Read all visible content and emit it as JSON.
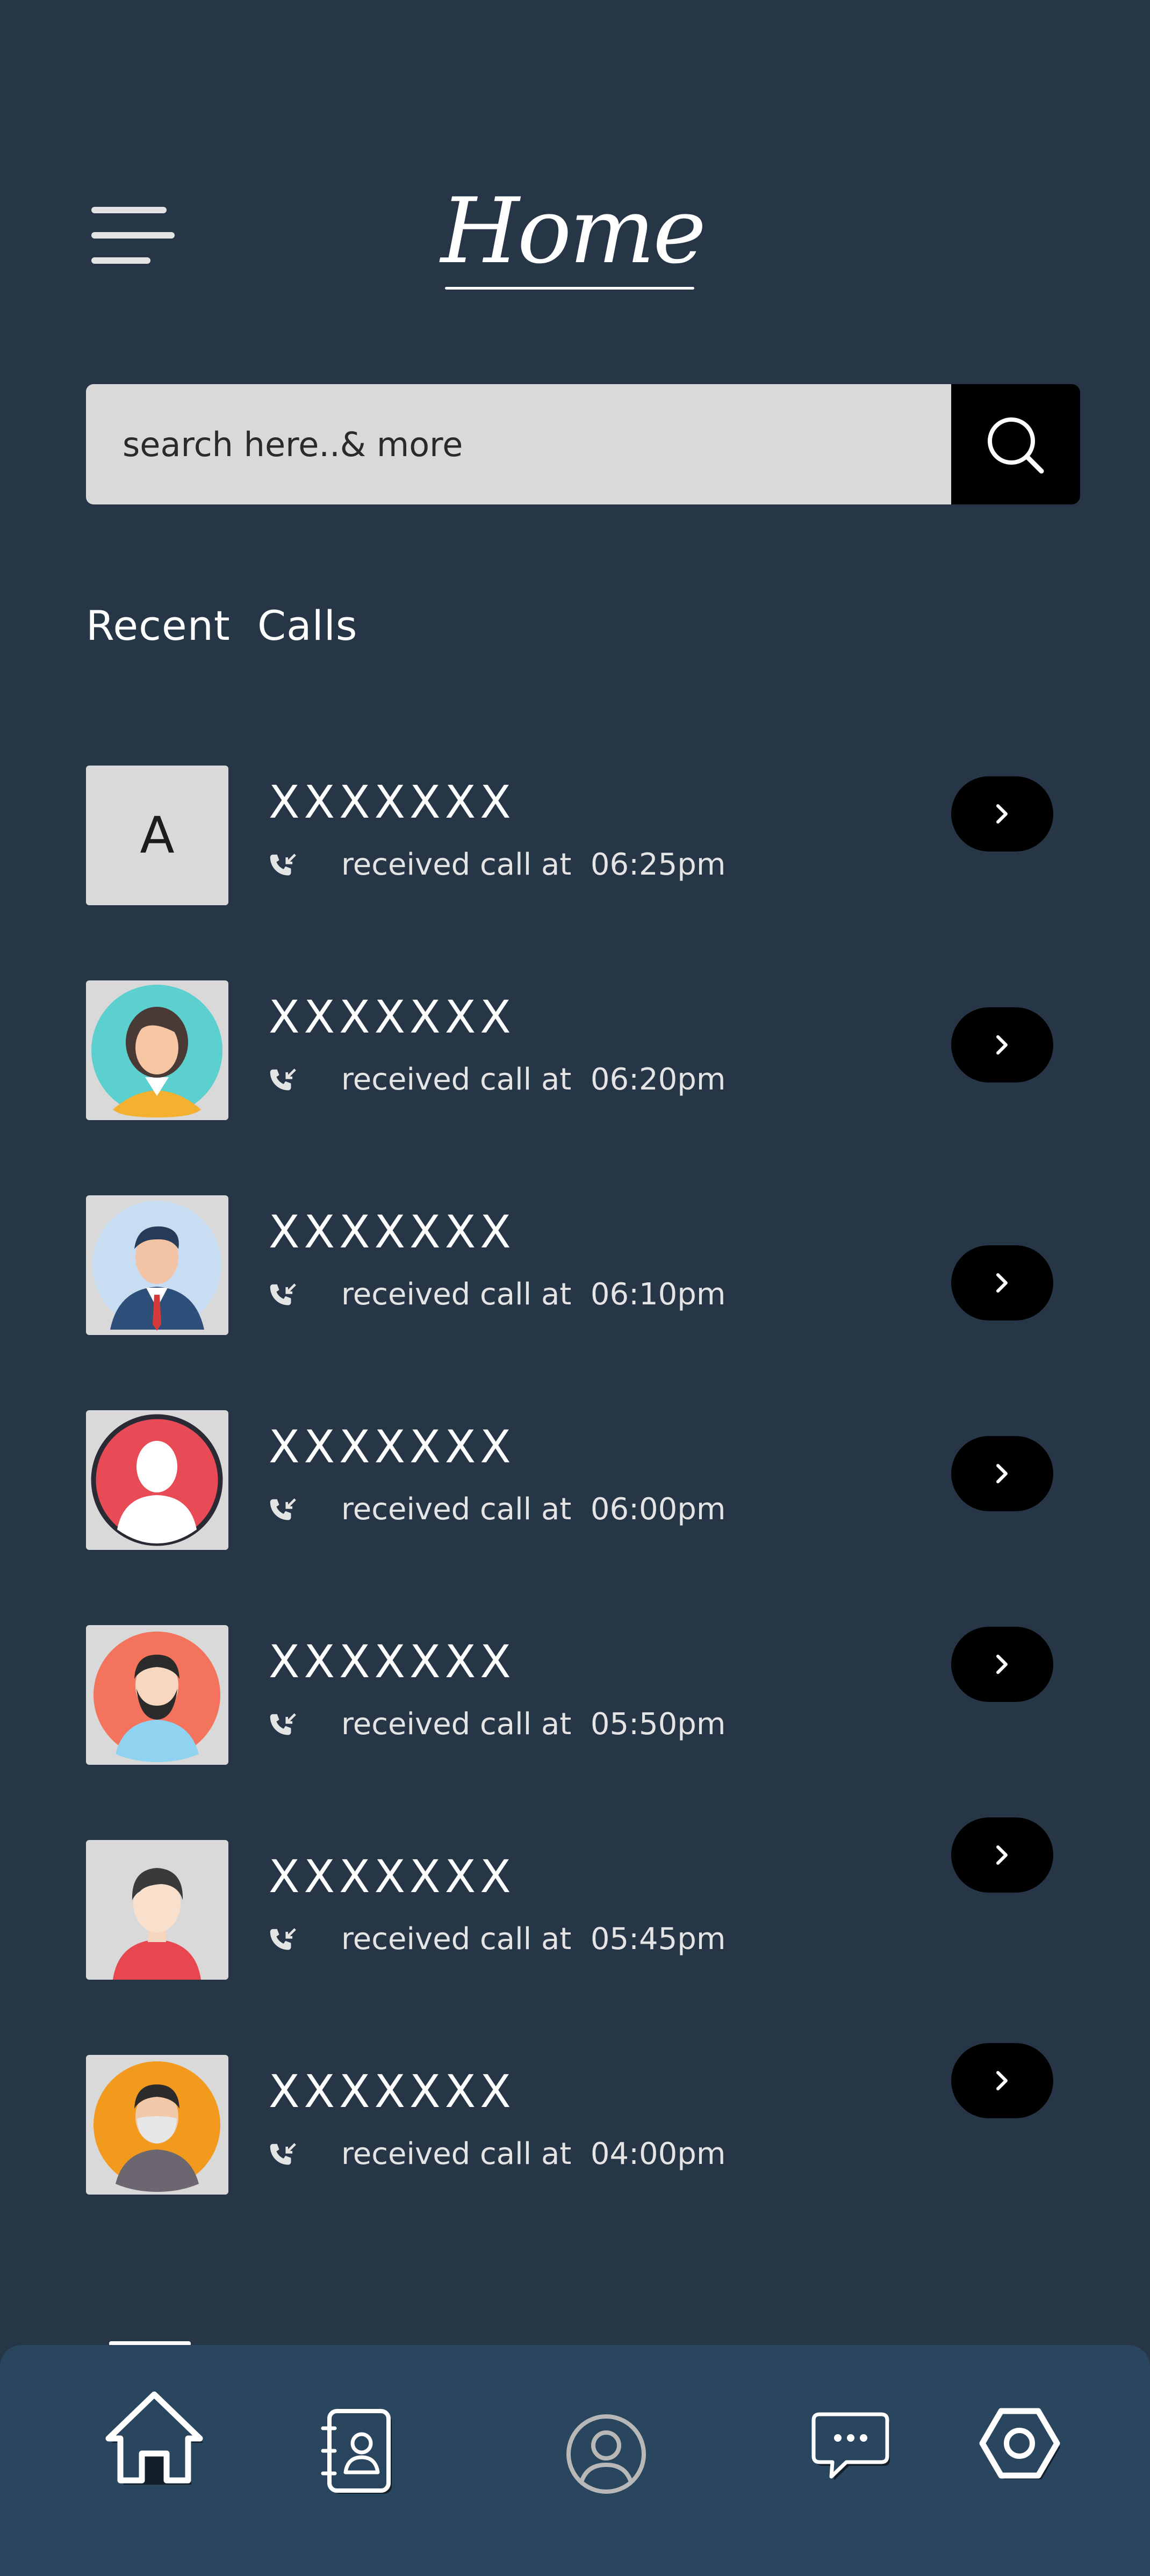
{
  "header": {
    "title": "Home"
  },
  "search": {
    "placeholder": "search here..& more"
  },
  "recent": {
    "heading": "Recent  Calls",
    "calls": [
      {
        "name": "XXXXXXX",
        "status": "received call at  06:25pm",
        "avatar": "letter-A",
        "letter": "A"
      },
      {
        "name": "XXXXXXX",
        "status": "received call at  06:20pm",
        "avatar": "woman-icon"
      },
      {
        "name": "XXXXXXX",
        "status": "received call at  06:10pm",
        "avatar": "businessman-icon"
      },
      {
        "name": "XXXXXXX",
        "status": "received call at  06:00pm",
        "avatar": "user-silhouette-icon"
      },
      {
        "name": "XXXXXXX",
        "status": "received call at  05:50pm",
        "avatar": "bearded-man-icon"
      },
      {
        "name": "XXXXXXX",
        "status": "received call at  05:45pm",
        "avatar": "man-icon"
      },
      {
        "name": "XXXXXXX",
        "status": "received call at  04:00pm",
        "avatar": "masked-man-icon"
      }
    ]
  },
  "bottom_nav": {
    "items": [
      "home-icon",
      "contacts-icon",
      "profile-icon",
      "messages-icon",
      "settings-icon"
    ],
    "active": "home-icon"
  },
  "colors": {
    "background": "#263646",
    "bottom_bar": "#2a455e",
    "search_field": "#d9d9d9",
    "button": "#000000"
  }
}
